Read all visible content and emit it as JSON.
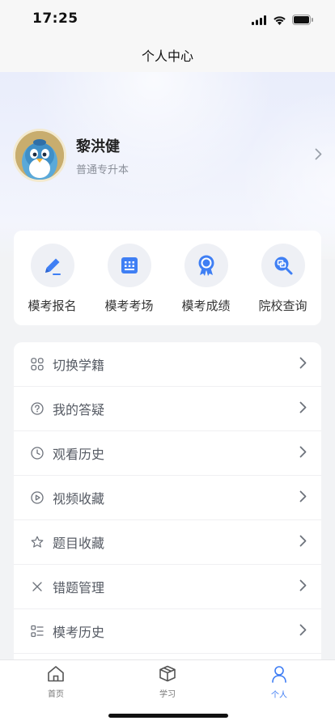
{
  "status_bar": {
    "time": "17:25"
  },
  "nav": {
    "title": "个人中心"
  },
  "profile": {
    "name": "黎洪健",
    "subtitle": "普通专升本"
  },
  "quick_actions": [
    {
      "label": "模考报名",
      "icon": "pencil-icon"
    },
    {
      "label": "模考考场",
      "icon": "exam-room-icon"
    },
    {
      "label": "模考成绩",
      "icon": "award-icon"
    },
    {
      "label": "院校查询",
      "icon": "school-search-icon"
    }
  ],
  "menu": [
    {
      "label": "切换学籍",
      "icon": "switch-grid-icon"
    },
    {
      "label": "我的答疑",
      "icon": "question-circle-icon"
    },
    {
      "label": "观看历史",
      "icon": "clock-icon"
    },
    {
      "label": "视频收藏",
      "icon": "play-circle-icon"
    },
    {
      "label": "题目收藏",
      "icon": "star-icon"
    },
    {
      "label": "错题管理",
      "icon": "cross-icon"
    },
    {
      "label": "模考历史",
      "icon": "list-icon"
    }
  ],
  "tab_bar": {
    "tabs": [
      {
        "label": "首页",
        "icon": "home-icon",
        "active": false
      },
      {
        "label": "学习",
        "icon": "box-icon",
        "active": false
      },
      {
        "label": "个人",
        "icon": "person-icon",
        "active": true
      }
    ]
  },
  "colors": {
    "accent": "#3d7cf4",
    "icon_blue": "#3f7ff4",
    "text_muted": "#8a8f99"
  }
}
